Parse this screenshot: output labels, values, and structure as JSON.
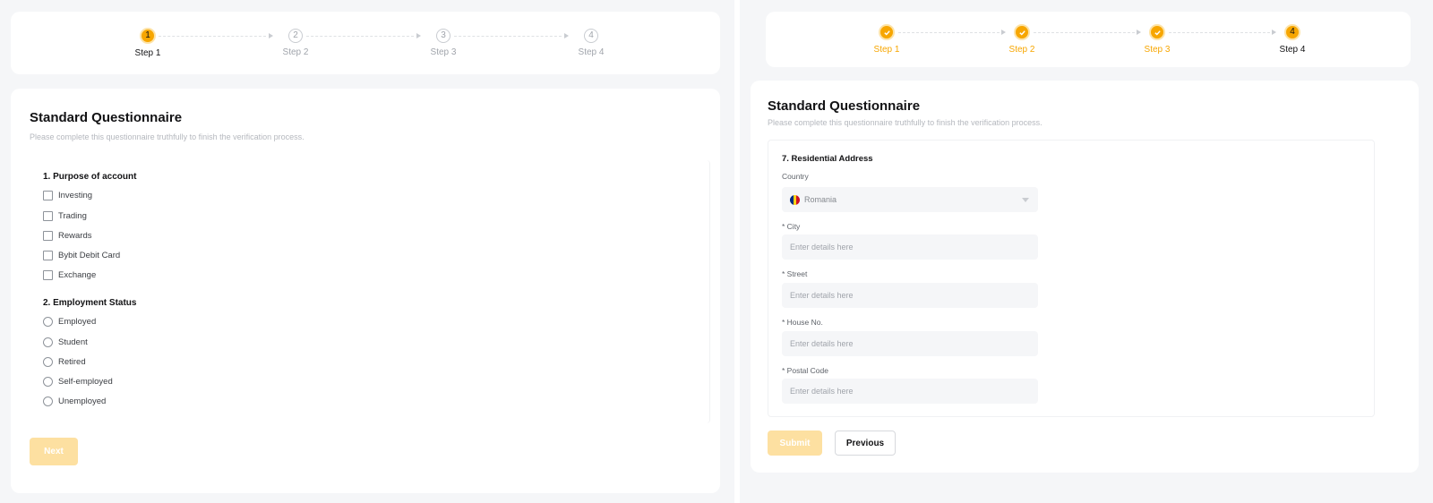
{
  "left": {
    "steps": [
      {
        "number": "1",
        "label": "Step 1",
        "state": "active"
      },
      {
        "number": "2",
        "label": "Step 2",
        "state": "pending"
      },
      {
        "number": "3",
        "label": "Step 3",
        "state": "pending"
      },
      {
        "number": "4",
        "label": "Step 4",
        "state": "pending"
      }
    ],
    "title": "Standard Questionnaire",
    "subtitle": "Please complete this questionnaire truthfully to finish the verification process.",
    "q1": {
      "title": "1. Purpose of account",
      "options": [
        "Investing",
        "Trading",
        "Rewards",
        "Bybit Debit Card",
        "Exchange"
      ]
    },
    "q2": {
      "title": "2. Employment Status",
      "options": [
        "Employed",
        "Student",
        "Retired",
        "Self-employed",
        "Unemployed"
      ]
    },
    "next_label": "Next"
  },
  "right": {
    "steps": [
      {
        "label": "Step 1",
        "state": "done"
      },
      {
        "label": "Step 2",
        "state": "done"
      },
      {
        "label": "Step 3",
        "state": "done"
      },
      {
        "number": "4",
        "label": "Step 4",
        "state": "current"
      }
    ],
    "title": "Standard Questionnaire",
    "subtitle": "Please complete this questionnaire truthfully to finish the verification process.",
    "section_title": "7. Residential Address",
    "country_label": "Country",
    "country_value": "Romania",
    "fields": [
      {
        "label": "* City",
        "placeholder": "Enter details here"
      },
      {
        "label": "* Street",
        "placeholder": "Enter details here"
      },
      {
        "label": "* House No.",
        "placeholder": "Enter details here"
      },
      {
        "label": "* Postal Code",
        "placeholder": "Enter details here"
      }
    ],
    "submit_label": "Submit",
    "previous_label": "Previous"
  },
  "colors": {
    "accent": "#f7a600",
    "accent_light": "#fde0a1",
    "background": "#f5f6f8"
  }
}
